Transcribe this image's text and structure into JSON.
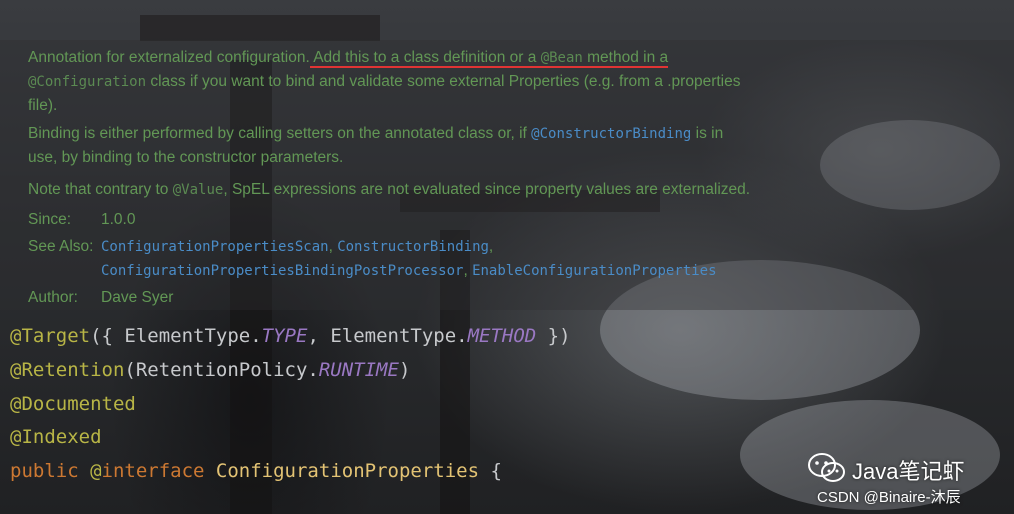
{
  "doc": {
    "p1_a": "Annotation for externalized configuration.",
    "p1_b": " Add this to a class definition or a ",
    "p1_bean": "@Bean",
    "p1_c": " method in a",
    "p1_config": "@Configuration",
    "p1_d": " class if you want to bind and validate some external Properties (e.g. from a .properties",
    "p1_e": "file).",
    "p2_a": "Binding is either performed by calling setters on the annotated class or, if ",
    "p2_link": "@ConstructorBinding",
    "p2_b": " is in",
    "p2_c": "use, by binding to the constructor parameters.",
    "p3_a": "Note that contrary to ",
    "p3_value": "@Value",
    "p3_b": ", SpEL expressions are not evaluated since property values are externalized.",
    "since_label": "Since:",
    "since_value": "1.0.0",
    "see_also_label": "See Also:",
    "see_also": [
      "ConfigurationPropertiesScan",
      "ConstructorBinding",
      "ConfigurationPropertiesBindingPostProcessor",
      "EnableConfigurationProperties"
    ],
    "author_label": "Author:",
    "author_value": "Dave Syer"
  },
  "code": {
    "l1_ann": "@Target",
    "l1_a": "({ ElementType.",
    "l1_type": "TYPE",
    "l1_b": ", ElementType.",
    "l1_method": "METHOD",
    "l1_c": " })",
    "l2_ann": "@Retention",
    "l2_a": "(RetentionPolicy.",
    "l2_runtime": "RUNTIME",
    "l2_b": ")",
    "l3_ann": "@Documented",
    "l4_ann": "@Indexed",
    "l5_public": "public",
    "l5_at": " @",
    "l5_interface": "interface",
    "l5_name": " ConfigurationProperties",
    "l5_brace": " {"
  },
  "watermark": {
    "brand": "Java笔记虾",
    "credit": "CSDN @Binaire-沐辰",
    "icon": "wechat-icon"
  },
  "colors": {
    "doc_text": "#629755",
    "link": "#4a8cc7",
    "annotation": "#b8b546",
    "keyword": "#cc7832",
    "constant": "#9a78c3",
    "class_name": "#e3c374",
    "highlight_underline": "#e03434"
  }
}
